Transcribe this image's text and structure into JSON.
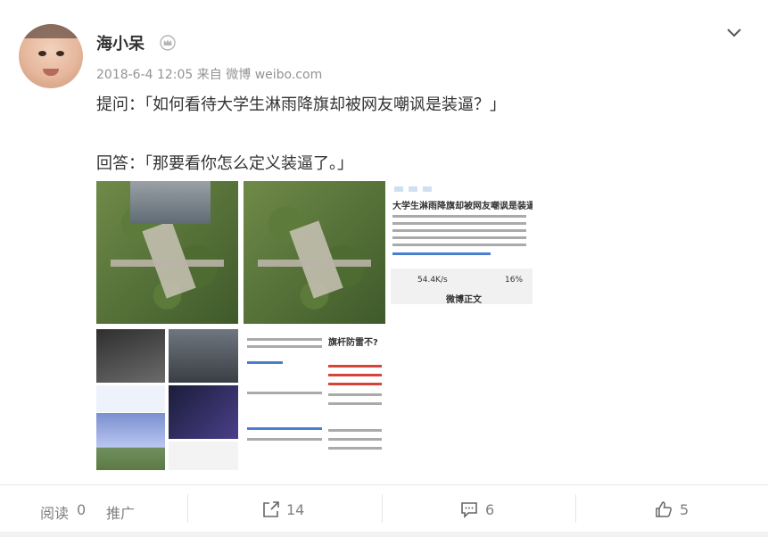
{
  "post": {
    "username": "海小呆",
    "meta": "2018-6-4 12:05 来自 微博 weibo.com",
    "line1": "提问：「如何看待大学生淋雨降旗却被网友嘲讽是装逼？」",
    "line2": "回答：「那要看你怎么定义装逼了。」"
  },
  "images": {
    "pic3_title": "大学生淋雨降旗却被网友嘲讽是装逼？",
    "pic3_speed": "54.4K/s",
    "pic3_battery": "16%",
    "pic3_button": "微博正文",
    "pic5_title": "旗杆防雷不?"
  },
  "actions": {
    "read_label": "阅读",
    "read_count": "0",
    "promote_label": "推广",
    "share_count": "14",
    "comment_count": "6",
    "like_count": "5"
  },
  "icons": {
    "vip": "vip-crown-icon",
    "more": "chevron-down-icon",
    "share": "share-icon",
    "comment": "comment-icon",
    "like": "thumbs-up-icon"
  },
  "colors": {
    "text": "#333333",
    "meta": "#939393",
    "action": "#808080"
  }
}
